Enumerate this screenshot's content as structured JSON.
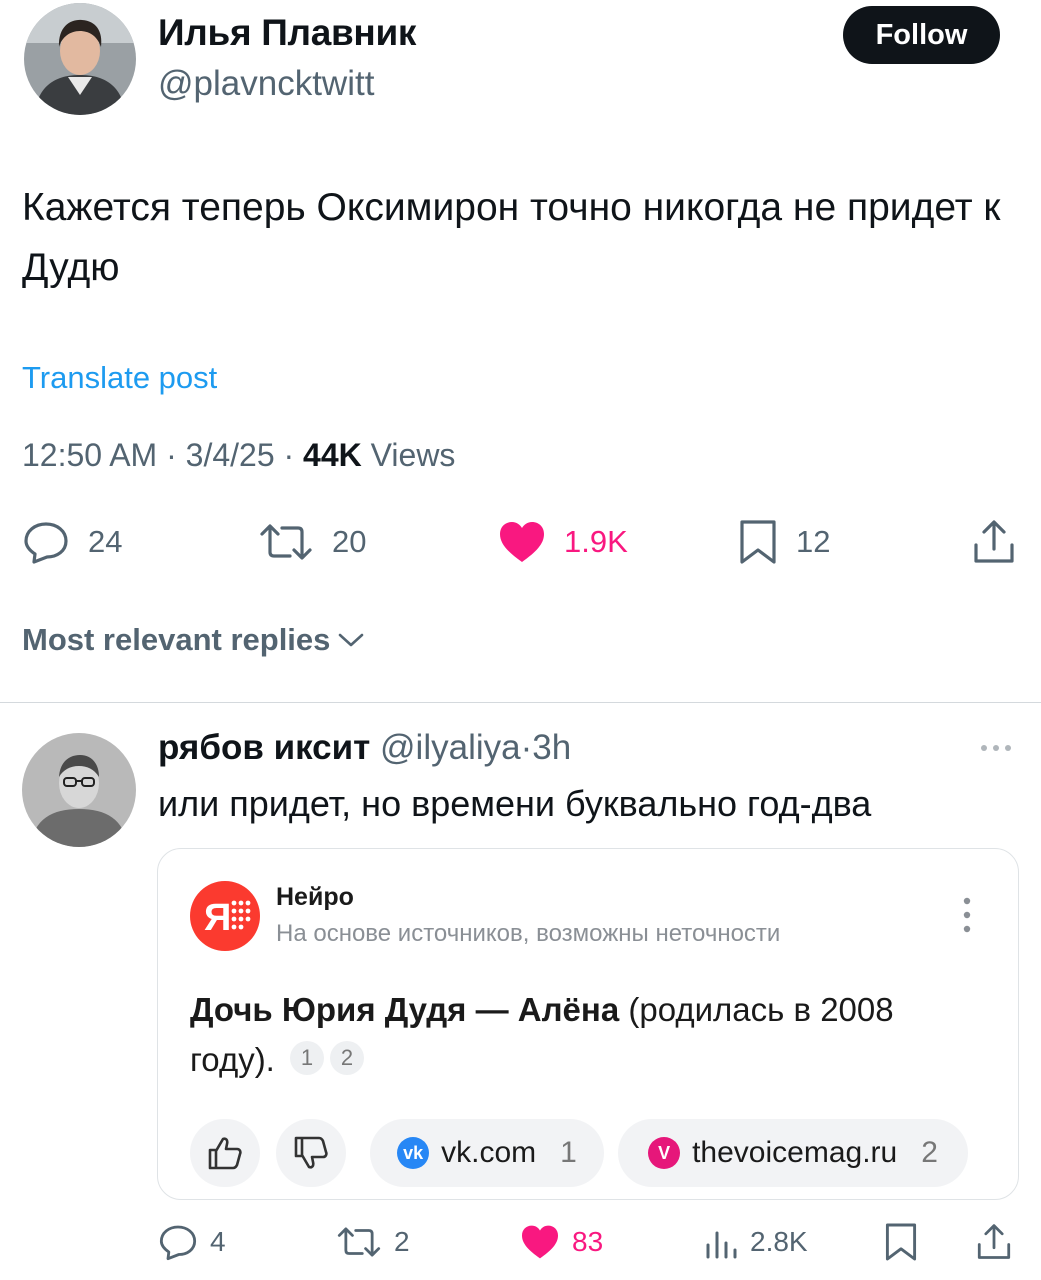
{
  "tweet": {
    "author_name": "Илья Плавник",
    "author_handle": "@plavncktwitt",
    "follow_label": "Follow",
    "text": "Кажется теперь Оксимирон точно никогда не придет к Дудю",
    "translate_label": "Translate post",
    "time": "12:50 AM",
    "date": "3/4/25",
    "views_count": "44K",
    "views_label": "Views",
    "replies": "24",
    "reposts": "20",
    "likes": "1.9K",
    "bookmarks": "12"
  },
  "replies_sort": {
    "label": "Most relevant replies"
  },
  "reply": {
    "author_name": "рябов иксит",
    "author_handle": "@ilyaliya",
    "age": "3h",
    "text": "или придет, но времени буквально год-два",
    "card": {
      "title": "Нейро",
      "subtitle": "На основе источников, возможны неточности",
      "answer_bold": "Дочь Юрия Дудя — Алёна",
      "answer_rest_line1": "(родилась в 2008",
      "answer_rest_line2": "году).",
      "refs": [
        "1",
        "2"
      ],
      "sources": [
        {
          "name": "vk.com",
          "num": "1",
          "badge": "vk",
          "color": "#2787f5"
        },
        {
          "name": "thevoicemag.ru",
          "num": "2",
          "badge": "V",
          "color": "#e6177a"
        }
      ]
    },
    "replies": "4",
    "reposts": "2",
    "likes": "83",
    "views": "2.8K"
  },
  "colors": {
    "accent": "#1d9bf0",
    "like": "#f91880",
    "muted": "#536471",
    "neuro_red": "#fb3a2f"
  }
}
